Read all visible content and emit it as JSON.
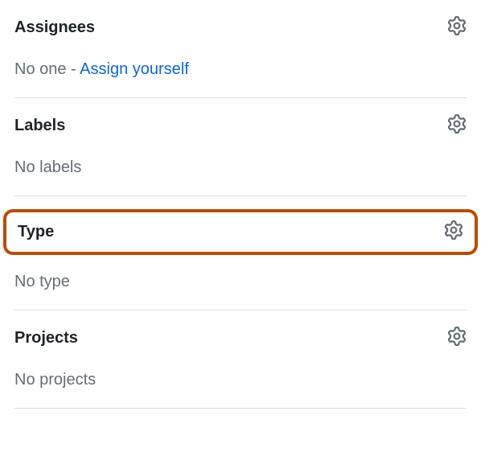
{
  "assignees": {
    "title": "Assignees",
    "empty_prefix": "No one - ",
    "assign_self_link": "Assign yourself"
  },
  "labels": {
    "title": "Labels",
    "empty_text": "No labels"
  },
  "type": {
    "title": "Type",
    "empty_text": "No type"
  },
  "projects": {
    "title": "Projects",
    "empty_text": "No projects"
  }
}
